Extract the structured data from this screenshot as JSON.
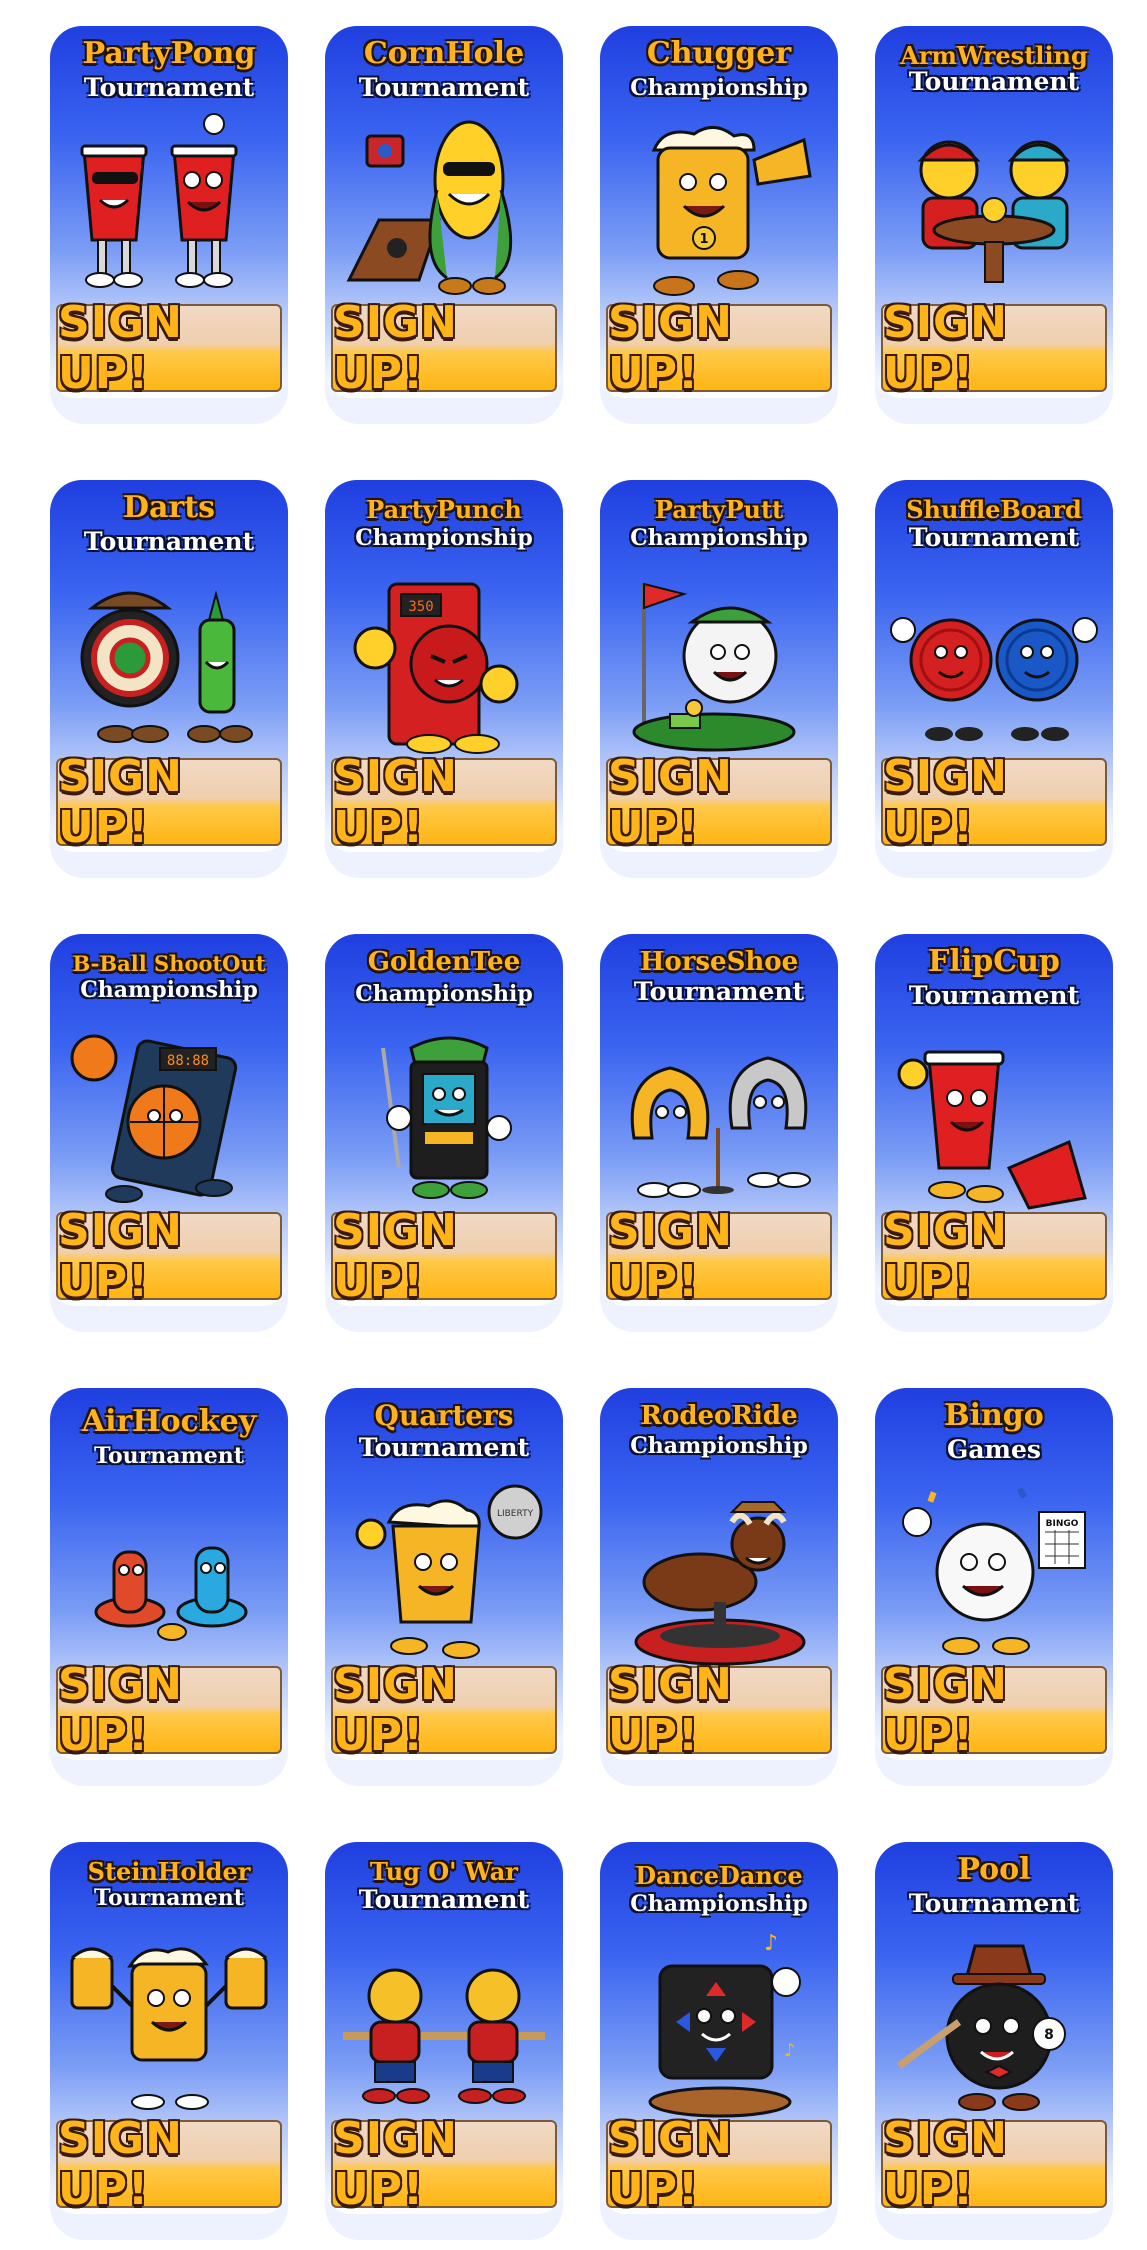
{
  "signup_label": "SIGN UP!",
  "cards": [
    {
      "title": "PartyPong",
      "subtitle": "Tournament"
    },
    {
      "title": "CornHole",
      "subtitle": "Tournament"
    },
    {
      "title": "Chugger",
      "subtitle": "Championship"
    },
    {
      "title": "ArmWrestling",
      "subtitle": "Tournament"
    },
    {
      "title": "Darts",
      "subtitle": "Tournament"
    },
    {
      "title": "PartyPunch",
      "subtitle": "Championship"
    },
    {
      "title": "PartyPutt",
      "subtitle": "Championship"
    },
    {
      "title": "ShuffleBoard",
      "subtitle": "Tournament"
    },
    {
      "title": "B-Ball ShootOut",
      "subtitle": "Championship"
    },
    {
      "title": "GoldenTee",
      "subtitle": "Championship"
    },
    {
      "title": "HorseShoe",
      "subtitle": "Tournament"
    },
    {
      "title": "FlipCup",
      "subtitle": "Tournament"
    },
    {
      "title": "AirHockey",
      "subtitle": "Tournament"
    },
    {
      "title": "Quarters",
      "subtitle": "Tournament"
    },
    {
      "title": "RodeoRide",
      "subtitle": "Championship"
    },
    {
      "title": "Bingo",
      "subtitle": "Games"
    },
    {
      "title": "SteinHolder",
      "subtitle": "Tournament"
    },
    {
      "title": "Tug O' War",
      "subtitle": "Tournament"
    },
    {
      "title": "DanceDance",
      "subtitle": "Championship"
    },
    {
      "title": "Pool",
      "subtitle": "Tournament"
    }
  ],
  "art_labels": {
    "punch_score": "350",
    "shot_clock": "88:88",
    "bingo_card": "BINGO",
    "coin_text": "LIBERTY",
    "medal_number": "1",
    "pool_ball_8": "8"
  },
  "colors": {
    "title": "#ffb21f",
    "card_top": "#1f3fe0",
    "card_bottom": "#ffffff",
    "signup_gold": "#ffb514"
  }
}
